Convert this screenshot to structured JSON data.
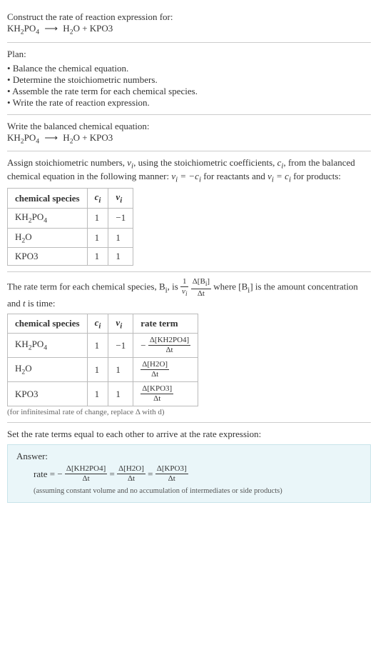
{
  "header": {
    "prompt": "Construct the rate of reaction expression for:",
    "eq_lhs": "KH",
    "eq_lhs_sub1": "2",
    "eq_lhs_mid": "PO",
    "eq_lhs_sub2": "4",
    "arrow": "⟶",
    "eq_rhs_h2o": "H",
    "eq_rhs_h2o_sub": "2",
    "eq_rhs_h2o_end": "O + KPO3"
  },
  "plan": {
    "title": "Plan:",
    "items": [
      "Balance the chemical equation.",
      "Determine the stoichiometric numbers.",
      "Assemble the rate term for each chemical species.",
      "Write the rate of reaction expression."
    ]
  },
  "balanced": {
    "title": "Write the balanced chemical equation:"
  },
  "stoich": {
    "intro_a": "Assign stoichiometric numbers, ",
    "nu_i": "ν_i",
    "intro_b": ", using the stoichiometric coefficients, ",
    "c_i": "c_i",
    "intro_c": ", from the balanced chemical equation in the following manner: ",
    "rel1": "ν_i = −c_i",
    "intro_d": " for reactants and ",
    "rel2": "ν_i = c_i",
    "intro_e": " for products:",
    "headers": {
      "species": "chemical species",
      "ci": "c_i",
      "nui": "ν_i"
    },
    "rows": [
      {
        "species_html": "KH2PO4",
        "ci": "1",
        "nui": "−1"
      },
      {
        "species_html": "H2O",
        "ci": "1",
        "nui": "1"
      },
      {
        "species_html": "KPO3",
        "ci": "1",
        "nui": "1"
      }
    ]
  },
  "rate_intro": {
    "a": "The rate term for each chemical species, B",
    "b": ", is ",
    "one_over_nu_num": "1",
    "one_over_nu_den": "ν_i",
    "dB_num": "Δ[B_i]",
    "dB_den": "Δt",
    "c": " where [B",
    "d": "] is the amount concentration and ",
    "t": "t",
    "e": " is time:"
  },
  "rate_table": {
    "headers": {
      "species": "chemical species",
      "ci": "c_i",
      "nui": "ν_i",
      "rate": "rate term"
    },
    "rows": [
      {
        "ci": "1",
        "nui": "−1",
        "num": "Δ[KH2PO4]",
        "den": "Δt",
        "neg": "−"
      },
      {
        "ci": "1",
        "nui": "1",
        "num": "Δ[H2O]",
        "den": "Δt",
        "neg": ""
      },
      {
        "ci": "1",
        "nui": "1",
        "num": "Δ[KPO3]",
        "den": "Δt",
        "neg": ""
      }
    ],
    "note": "(for infinitesimal rate of change, replace Δ with d)"
  },
  "final": {
    "title": "Set the rate terms equal to each other to arrive at the rate expression:",
    "answer_label": "Answer:",
    "rate_label": "rate = ",
    "neg": "−",
    "t1_num": "Δ[KH2PO4]",
    "t1_den": "Δt",
    "eq": " = ",
    "t2_num": "Δ[H2O]",
    "t2_den": "Δt",
    "t3_num": "Δ[KPO3]",
    "t3_den": "Δt",
    "assume": "(assuming constant volume and no accumulation of intermediates or side products)"
  },
  "chart_data": {
    "type": "table",
    "tables": [
      {
        "title": "Stoichiometric numbers",
        "columns": [
          "chemical species",
          "c_i",
          "ν_i"
        ],
        "rows": [
          [
            "KH2PO4",
            1,
            -1
          ],
          [
            "H2O",
            1,
            1
          ],
          [
            "KPO3",
            1,
            1
          ]
        ]
      },
      {
        "title": "Rate terms",
        "columns": [
          "chemical species",
          "c_i",
          "ν_i",
          "rate term"
        ],
        "rows": [
          [
            "KH2PO4",
            1,
            -1,
            "-Δ[KH2PO4]/Δt"
          ],
          [
            "H2O",
            1,
            1,
            "Δ[H2O]/Δt"
          ],
          [
            "KPO3",
            1,
            1,
            "Δ[KPO3]/Δt"
          ]
        ]
      }
    ],
    "final_expression": "rate = -Δ[KH2PO4]/Δt = Δ[H2O]/Δt = Δ[KPO3]/Δt"
  }
}
